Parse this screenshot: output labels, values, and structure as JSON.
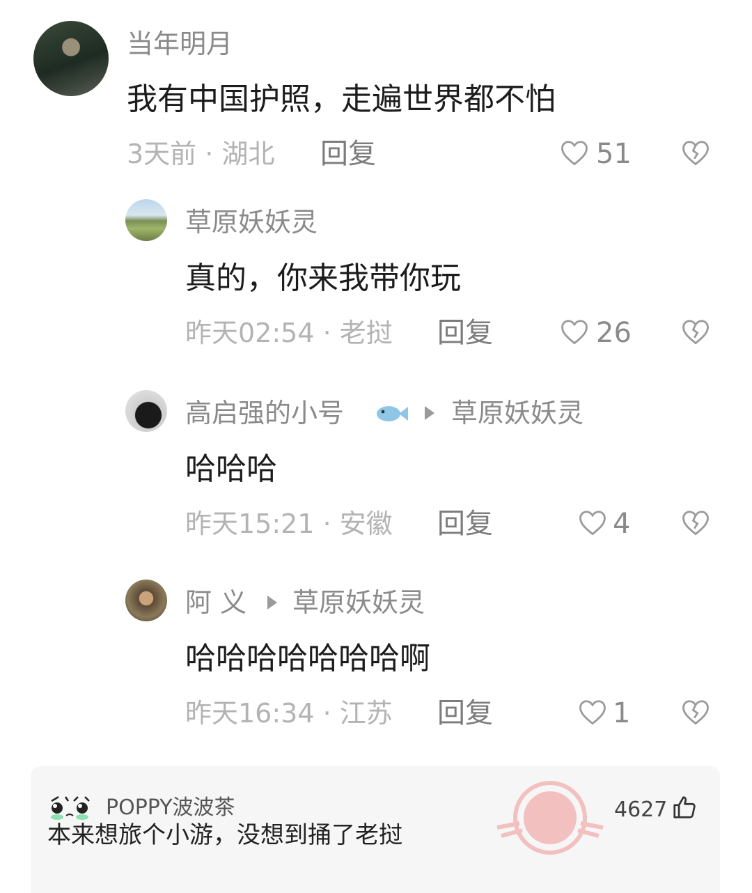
{
  "comments": [
    {
      "username": "当年明月",
      "text": "我有中国护照，走遍世界都不怕",
      "meta": "3天前 · 湖北",
      "reply_label": "回复",
      "likes": "51"
    },
    {
      "username": "草原妖妖灵",
      "text": "真的，你来我带你玩",
      "meta": "昨天02:54 · 老挝",
      "reply_label": "回复",
      "likes": "26"
    },
    {
      "username": "高启强的小号",
      "reply_to": "草原妖妖灵",
      "text": "哈哈哈",
      "meta": "昨天15:21 · 安徽",
      "reply_label": "回复",
      "likes": "4"
    },
    {
      "username": "阿 义",
      "reply_to": "草原妖妖灵",
      "text": "哈哈哈哈哈哈哈啊",
      "meta": "昨天16:34 · 江苏",
      "reply_label": "回复",
      "likes": "1"
    }
  ],
  "hot_comment": {
    "username": "POPPY波波茶",
    "text": "本来想旅个小游，没想到捅了老挝",
    "likes": "4627"
  },
  "icons": {
    "like": "heart-outline-icon",
    "dislike": "broken-heart-icon",
    "hot_like": "thumbs-up-icon"
  },
  "colors": {
    "username": "#8a8a8a",
    "content": "#1c1c1c",
    "meta": "#b3b3b3",
    "icon": "#9a9a9a",
    "watermark": "#e53935"
  }
}
